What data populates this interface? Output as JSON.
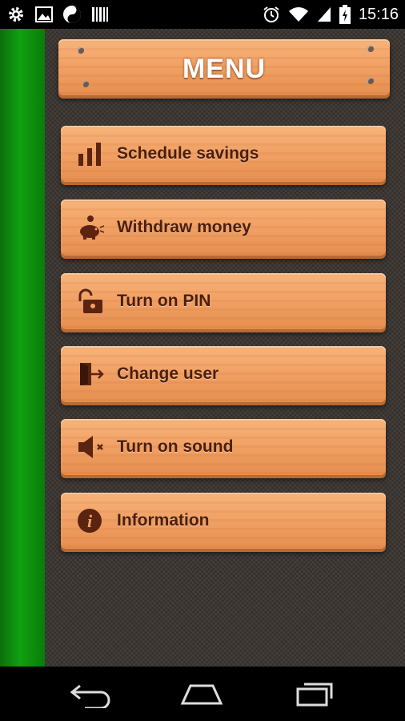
{
  "status_bar": {
    "time": "15:16",
    "left_icons": [
      "settings-icon",
      "image-icon",
      "yin-yang-icon",
      "barcode-icon"
    ],
    "right_icons": [
      "alarm-icon",
      "wifi-icon",
      "signal-icon",
      "battery-charging-icon"
    ]
  },
  "menu": {
    "title": "MENU",
    "items": [
      {
        "label": "Schedule savings",
        "icon": "bar-chart-icon"
      },
      {
        "label": "Withdraw money",
        "icon": "piggy-bank-icon"
      },
      {
        "label": "Turn on PIN",
        "icon": "unlocked-padlock-icon"
      },
      {
        "label": "Change user",
        "icon": "exit-door-icon"
      },
      {
        "label": "Turn on sound",
        "icon": "speaker-muted-icon"
      },
      {
        "label": "Information",
        "icon": "info-icon"
      }
    ]
  },
  "colors": {
    "plank": "#f2a266",
    "label_text": "#4a1f0e",
    "panel_bg": "#3a3430",
    "left_strip": "#0fa10f"
  },
  "nav_bar": {
    "buttons": [
      "back-icon",
      "home-icon",
      "recents-icon"
    ]
  }
}
